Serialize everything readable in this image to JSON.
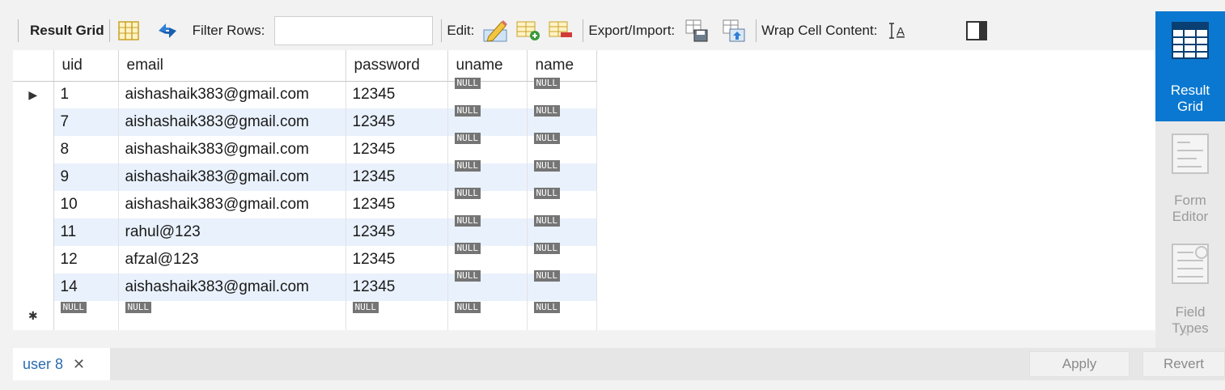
{
  "toolbar": {
    "result_grid_label": "Result Grid",
    "filter_label": "Filter Rows:",
    "filter_value": "",
    "edit_label": "Edit:",
    "export_label": "Export/Import:",
    "wrap_label": "Wrap Cell Content:"
  },
  "grid": {
    "columns": [
      "uid",
      "email",
      "password",
      "uname",
      "name"
    ],
    "null_label": "NULL",
    "rows": [
      {
        "uid": "1",
        "email": "aishashaik383@gmail.com",
        "password": "12345"
      },
      {
        "uid": "7",
        "email": "aishashaik383@gmail.com",
        "password": "12345"
      },
      {
        "uid": "8",
        "email": "aishashaik383@gmail.com",
        "password": "12345"
      },
      {
        "uid": "9",
        "email": "aishashaik383@gmail.com",
        "password": "12345"
      },
      {
        "uid": "10",
        "email": "aishashaik383@gmail.com",
        "password": "12345"
      },
      {
        "uid": "11",
        "email": "rahul@123",
        "password": "12345"
      },
      {
        "uid": "12",
        "email": "afzal@123",
        "password": "12345"
      },
      {
        "uid": "14",
        "email": "aishashaik383@gmail.com",
        "password": "12345"
      }
    ]
  },
  "side_panel": {
    "result_grid": [
      "Result",
      "Grid"
    ],
    "form_editor": [
      "Form",
      "Editor"
    ],
    "field_types": [
      "Field",
      "Types"
    ]
  },
  "bottom": {
    "tab_label": "user 8",
    "apply_label": "Apply",
    "revert_label": "Revert"
  },
  "colors": {
    "accent": "#0a78d0",
    "row_alt": "#e9f1fc",
    "null_badge": "#757575",
    "tab_text": "#2b6cb0"
  }
}
